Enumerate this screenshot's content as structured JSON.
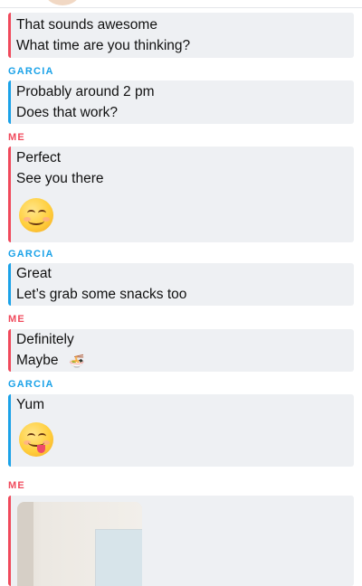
{
  "theme": {
    "me_color": "#f0495b",
    "them_color": "#1aa2e8",
    "bubble_bg": "#eef0f3"
  },
  "messages": [
    {
      "sender": "ME",
      "lines": [
        "That sounds awesome",
        "What time are you thinking?"
      ]
    },
    {
      "sender": "GARCIA",
      "lines": [
        "Probably around 2 pm",
        "Does that work?"
      ]
    },
    {
      "sender": "ME",
      "lines": [
        "Perfect",
        "See you there"
      ],
      "emoji": "smiling-face-emoji"
    },
    {
      "sender": "GARCIA",
      "lines": [
        "Great",
        "Let’s grab some snacks too"
      ]
    },
    {
      "sender": "ME",
      "lines": [
        "Definitely",
        "Maybe"
      ],
      "inline_emoji": "🍜"
    },
    {
      "sender": "GARCIA",
      "lines": [
        "Yum"
      ],
      "emoji": "face-savoring-food-emoji"
    },
    {
      "sender": "ME",
      "attachment": "photo"
    }
  ]
}
